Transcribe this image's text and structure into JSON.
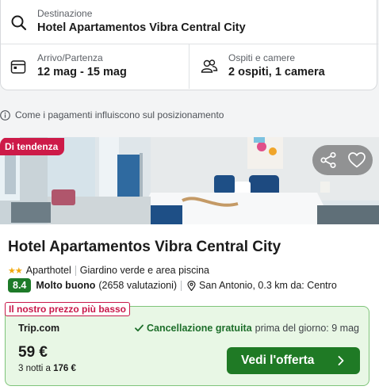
{
  "search": {
    "destination_label": "Destinazione",
    "destination_value": "Hotel Apartamentos Vibra Central City",
    "dates_label": "Arrivo/Partenza",
    "dates_value": "12 mag - 15 mag",
    "guests_label": "Ospiti e camere",
    "guests_value": "2 ospiti, 1 camera"
  },
  "info": {
    "text": "Come i pagamenti influiscono sul posizionamento",
    "icon": "info-icon"
  },
  "hotel": {
    "badge": "Di tendenza",
    "name": "Hotel Apartamentos Vibra Central City",
    "stars": "★★",
    "type": "Aparthotel",
    "feature": "Giardino verde e area piscina",
    "score": "8.4",
    "rating_word": "Molto buono",
    "reviews": "(2658 valutazioni)",
    "location": "San Antonio, 0.3 km da: Centro",
    "icons": [
      "share-icon",
      "heart-icon",
      "location-pin-icon"
    ]
  },
  "offer": {
    "tag": "Il nostro prezzo più basso",
    "provider": "Trip.com",
    "cancel_strong": "Cancellazione gratuita",
    "cancel_rest": "prima del giorno: 9 mag",
    "price": "59 €",
    "nights_prefix": "3 notti a",
    "nights_total": "176 €",
    "cta_label": "Vedi l'offerta"
  },
  "colors": {
    "accent_green": "#1f7a25",
    "trend_red": "#cd1a48",
    "offer_bg": "#e8f7e5"
  }
}
